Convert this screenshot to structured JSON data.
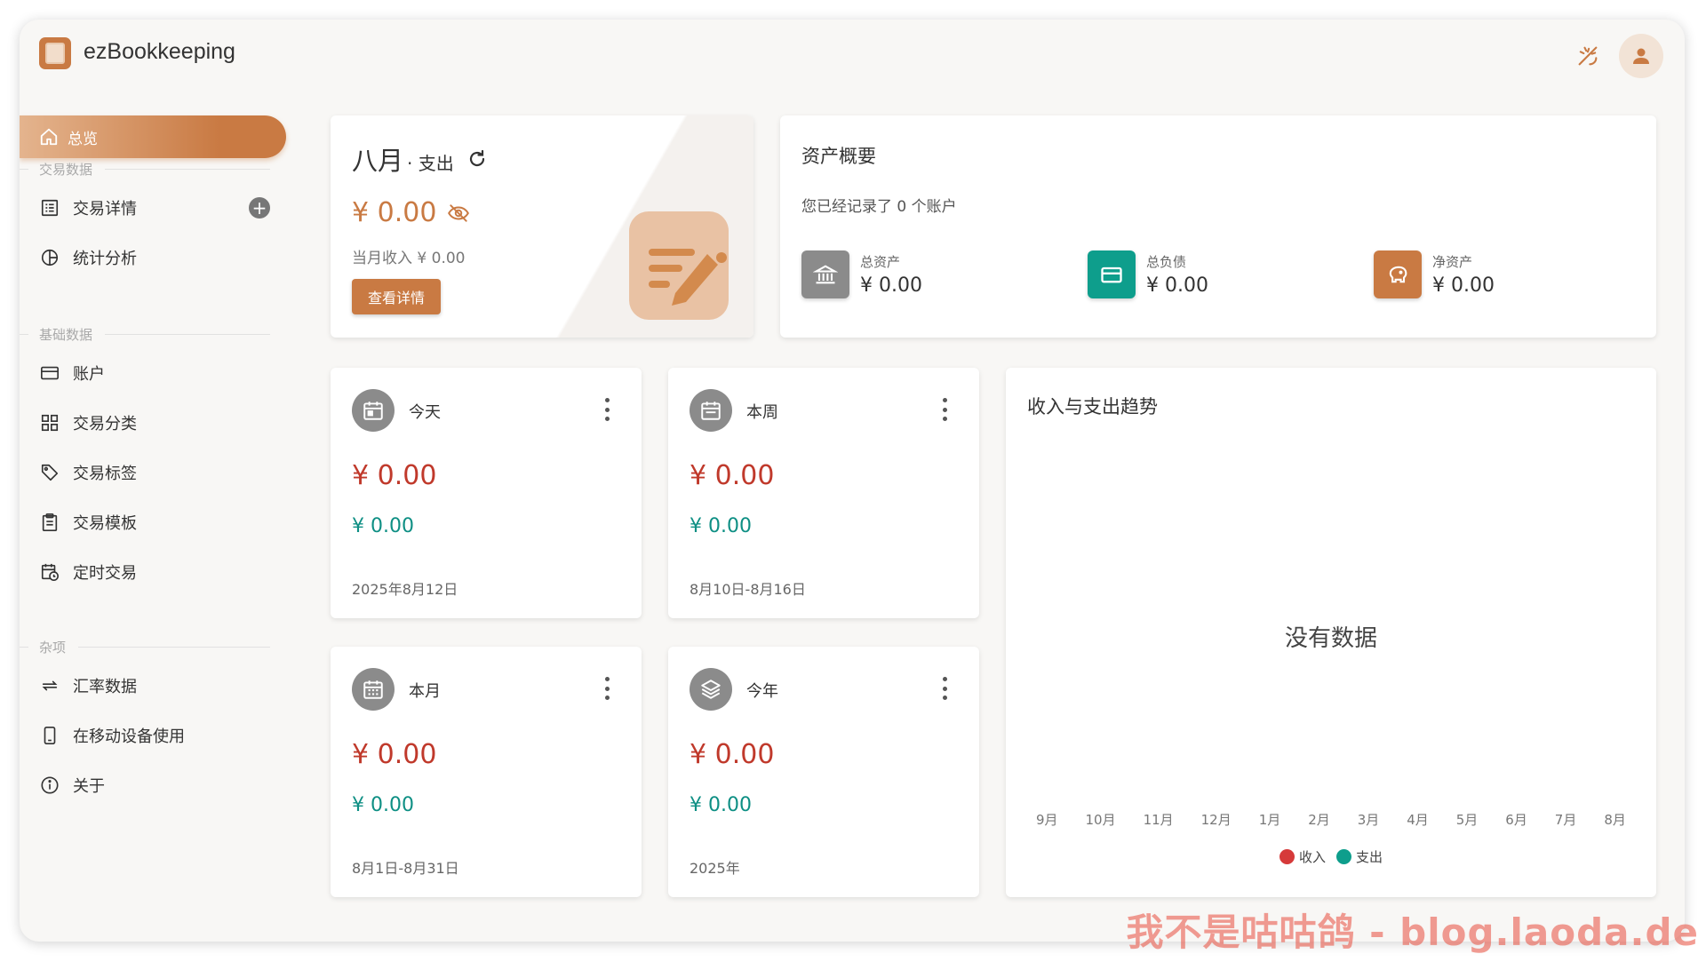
{
  "app": {
    "title": "ezBookkeeping"
  },
  "colors": {
    "accent": "#c97a43",
    "expense": "#c0392b",
    "income": "#0e8f84"
  },
  "topbar": {
    "icons": [
      "theme-icon",
      "user-avatar-icon"
    ]
  },
  "sidebar": {
    "active": {
      "label": "总览",
      "icon": "home-icon"
    },
    "sections": [
      {
        "label": "交易数据",
        "items": [
          {
            "label": "交易详情",
            "icon": "list-icon"
          },
          {
            "label": "统计分析",
            "icon": "pie-chart-icon"
          }
        ]
      },
      {
        "label": "基础数据",
        "items": [
          {
            "label": "账户",
            "icon": "card-icon"
          },
          {
            "label": "交易分类",
            "icon": "category-icon"
          },
          {
            "label": "交易标签",
            "icon": "tag-icon"
          },
          {
            "label": "交易模板",
            "icon": "clipboard-icon"
          },
          {
            "label": "定时交易",
            "icon": "calendar-clock-icon"
          }
        ]
      },
      {
        "label": "杂项",
        "items": [
          {
            "label": "汇率数据",
            "icon": "swap-icon"
          },
          {
            "label": "在移动设备使用",
            "icon": "phone-icon"
          },
          {
            "label": "关于",
            "icon": "info-icon"
          }
        ]
      }
    ],
    "add_symbol": "+"
  },
  "month_card": {
    "month": "八月",
    "sub": "· 支出",
    "expense": "¥ 0.00",
    "income_text": "当月收入  ¥ 0.00",
    "button": "查看详情"
  },
  "asset_card": {
    "title": "资产概要",
    "desc": "您已经记录了 0 个账户",
    "items": [
      {
        "label": "总资产",
        "value": "¥ 0.00",
        "color": "#8b8b8b",
        "icon": "bank-icon"
      },
      {
        "label": "总负债",
        "value": "¥ 0.00",
        "color": "#0e9e8c",
        "icon": "credit-card-icon"
      },
      {
        "label": "净资产",
        "value": "¥ 0.00",
        "color": "#c97a43",
        "icon": "piggy-bank-icon"
      }
    ]
  },
  "periods": [
    {
      "name": "今天",
      "expense": "¥ 0.00",
      "income": "¥ 0.00",
      "range": "2025年8月12日",
      "icon": "calendar-day-icon"
    },
    {
      "name": "本周",
      "expense": "¥ 0.00",
      "income": "¥ 0.00",
      "range": "8月10日-8月16日",
      "icon": "calendar-week-icon"
    },
    {
      "name": "本月",
      "expense": "¥ 0.00",
      "income": "¥ 0.00",
      "range": "8月1日-8月31日",
      "icon": "calendar-month-icon"
    },
    {
      "name": "今年",
      "expense": "¥ 0.00",
      "income": "¥ 0.00",
      "range": "2025年",
      "icon": "layers-icon"
    }
  ],
  "trend": {
    "title": "收入与支出趋势",
    "no_data": "没有数据",
    "months": [
      "9月",
      "10月",
      "11月",
      "12月",
      "1月",
      "2月",
      "3月",
      "4月",
      "5月",
      "6月",
      "7月",
      "8月"
    ],
    "legend": [
      {
        "name": "收入",
        "color": "#d63a3a"
      },
      {
        "name": "支出",
        "color": "#0e9e8c"
      }
    ]
  },
  "watermark": "我不是咕咕鸽 - blog.laoda.de"
}
